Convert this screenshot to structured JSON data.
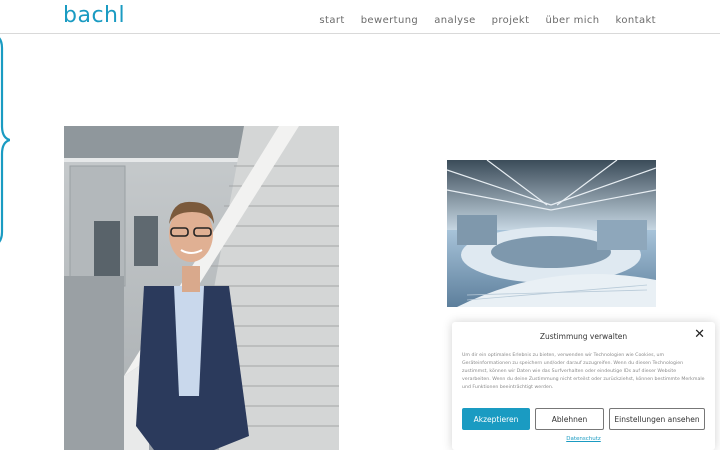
{
  "header": {
    "logo": "bachl",
    "nav": [
      "start",
      "bewertung",
      "analyse",
      "projekt",
      "über mich",
      "kontakt"
    ]
  },
  "colors": {
    "accent": "#1a9bc2",
    "text": "#6b6b6b"
  },
  "consent": {
    "title": "Zustimmung verwalten",
    "close_icon": "close-icon",
    "text": "Um dir ein optimales Erlebnis zu bieten, verwenden wir Technologien wie Cookies, um Geräteinformationen zu speichern und/oder darauf zuzugreifen. Wenn du diesen Technologien zustimmst, können wir Daten wie das Surfverhalten oder eindeutige IDs auf dieser Website verarbeiten. Wenn du deine Zustimmung nicht erteilst oder zurückziehst, können bestimmte Merkmale und Funktionen beeinträchtigt werden.",
    "accept": "Akzeptieren",
    "reject": "Ablehnen",
    "settings": "Einstellungen ansehen",
    "privacy_link": "Datenschutz"
  }
}
